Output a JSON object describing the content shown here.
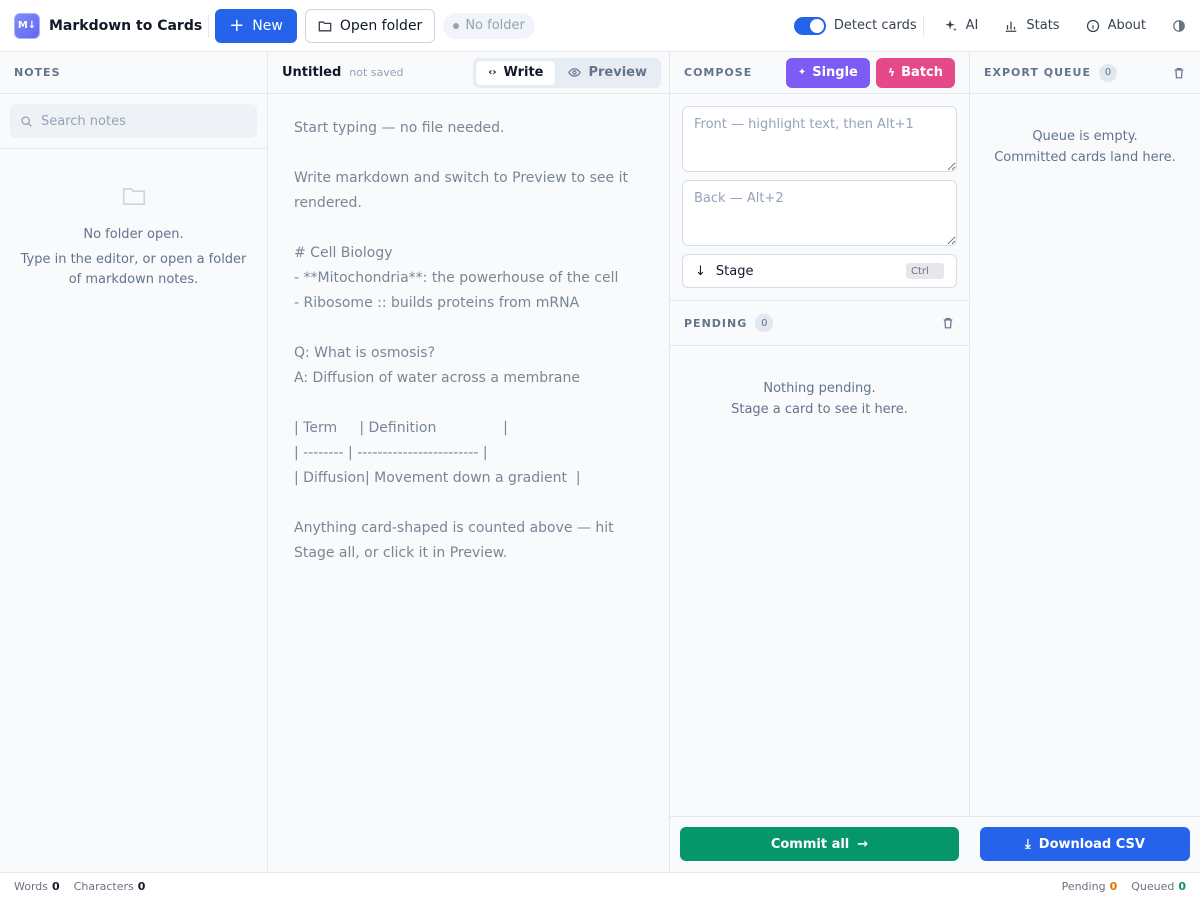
{
  "header": {
    "logo_text": "M↓",
    "title": "Markdown to Cards",
    "new_label": "New",
    "open_folder_label": "Open folder",
    "folder_chip": "No folder",
    "detect_label": "Detect cards",
    "ai_label": "AI",
    "stats_label": "Stats",
    "about_label": "About"
  },
  "notes": {
    "section_title": "NOTES",
    "search_placeholder": "Search notes",
    "empty_line1": "No folder open.",
    "empty_line2": "Type in the editor, or open a folder of markdown notes."
  },
  "editor": {
    "doc_name": "Untitled",
    "doc_state": "not saved",
    "write_label": "Write",
    "preview_label": "Preview",
    "content": "Start typing — no file needed.\n\nWrite markdown and switch to Preview to see it rendered.\n\n# Cell Biology\n- **Mitochondria**: the powerhouse of the cell\n- Ribosome :: builds proteins from mRNA\n\nQ: What is osmosis?\nA: Diffusion of water across a membrane\n\n| Term     | Definition               |\n| -------- | ------------------------ |\n| Diffusion| Movement down a gradient  |\n\nAnything card-shaped is counted above — hit Stage all, or click it in Preview."
  },
  "compose": {
    "section_title": "COMPOSE",
    "single_label": "Single",
    "batch_label": "Batch",
    "front_placeholder": "Front — highlight text, then Alt+1",
    "back_placeholder": "Back — Alt+2",
    "stage_label": "Stage",
    "stage_kbd": "Ctrl",
    "pending_title": "PENDING",
    "pending_count": "0",
    "pending_empty_line1": "Nothing pending.",
    "pending_empty_line2": "Stage a card to see it here.",
    "commit_label": "Commit all"
  },
  "export": {
    "section_title": "EXPORT QUEUE",
    "count": "0",
    "empty_line1": "Queue is empty.",
    "empty_line2": "Committed cards land here.",
    "download_label": "Download CSV"
  },
  "status": {
    "words_label": "Words",
    "words_value": "0",
    "chars_label": "Characters",
    "chars_value": "0",
    "pending_label": "Pending",
    "pending_value": "0",
    "queued_label": "Queued",
    "queued_value": "0"
  },
  "colors": {
    "primary": "#2563eb",
    "single": "#7c5cf2",
    "batch": "#e6498a",
    "commit": "#059669",
    "pending_accent": "#d97706"
  }
}
